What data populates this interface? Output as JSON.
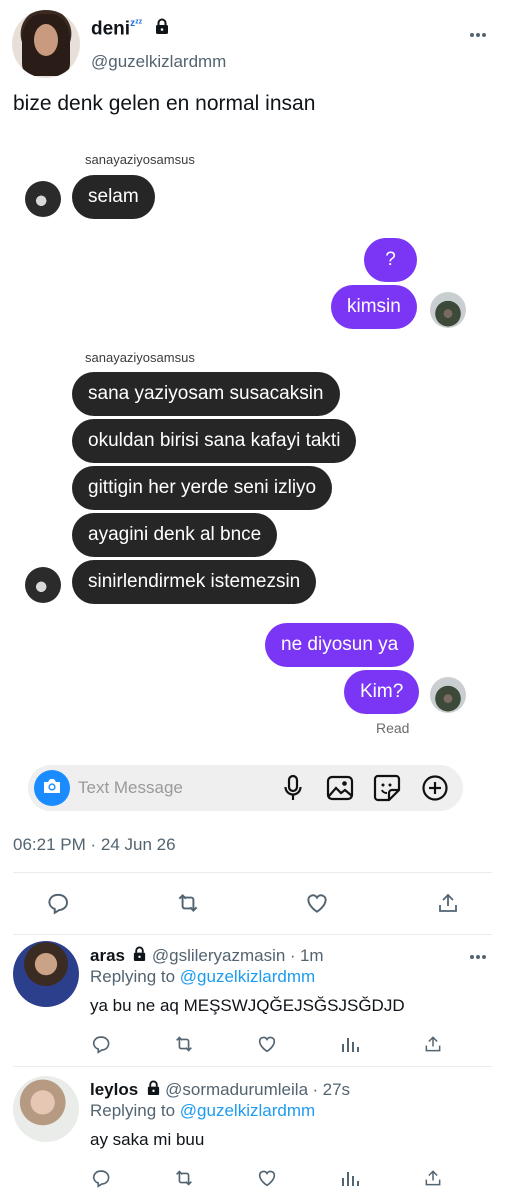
{
  "author": {
    "display_name": "deni",
    "name_suffix": "zᶻᶻ",
    "handle": "@guzelkizlardmm",
    "avatar": "profile-photo",
    "locked": true
  },
  "tweet": {
    "text": "bize denk gelen en normal insan",
    "timestamp": "06:21 PM · 24 Jun 26"
  },
  "chat": {
    "sender_label_1": "sanayaziyosamsus",
    "msg_1": "selam",
    "reply_1": "?",
    "reply_2": "kimsin",
    "sender_label_2": "sanayaziyosamsus",
    "msg_2": "sana yaziyosam susacaksin",
    "msg_3": "okuldan birisi sana kafayi takti",
    "msg_4": "gittigin her yerde seni izliyo",
    "msg_5": "ayagini denk al bnce",
    "msg_6": "sinirlendirmek istemezsin",
    "reply_3": "ne diyosun ya",
    "reply_4": "Kim?",
    "read_label": "Read",
    "composer_placeholder": "Text Message"
  },
  "replies": [
    {
      "name": "aras",
      "handle": "@gslileryazmasin",
      "time": "1m",
      "replying_prefix": "Replying to",
      "replying_to": "@guzelkizlardmm",
      "text": "ya bu ne aq MEŞSWJQĞEJSĞSJSĞDJD"
    },
    {
      "name": "leylos",
      "handle": "@sormadurumleila",
      "time": "27s",
      "replying_prefix": "Replying to",
      "replying_to": "@guzelkizlardmm",
      "text": "ay saka mi buu"
    }
  ],
  "colors": {
    "outgoing_bubble": "#7b36f5",
    "incoming_bubble": "#262626",
    "link": "#1d9bf0",
    "muted": "#536471"
  }
}
